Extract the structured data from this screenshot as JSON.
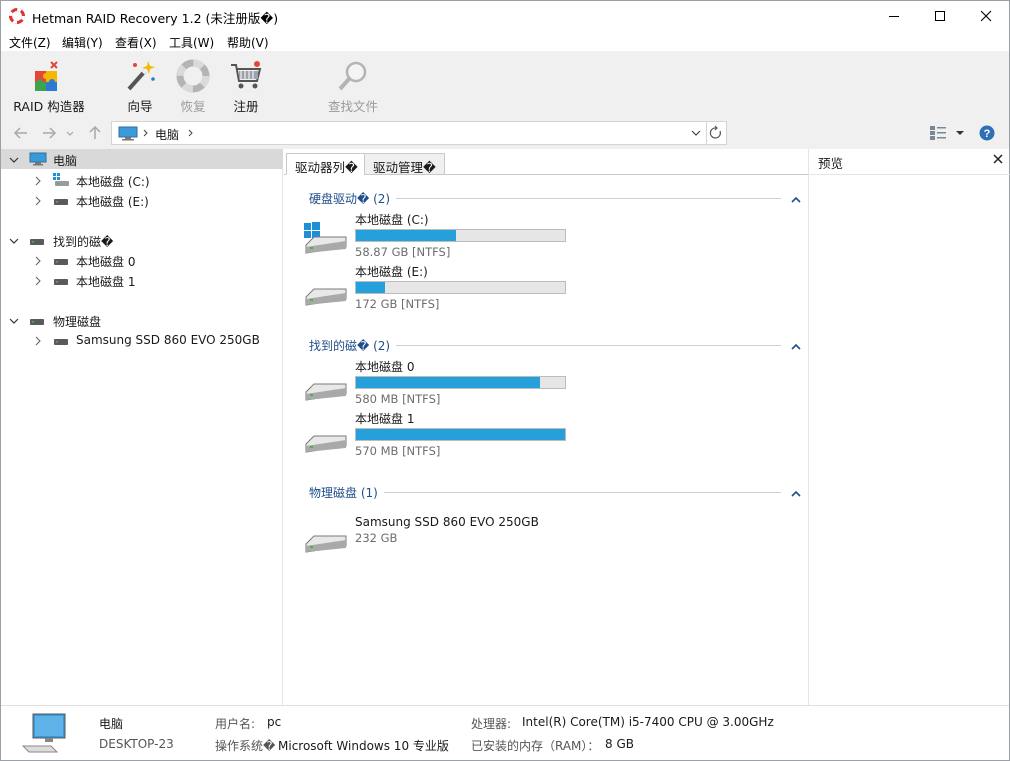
{
  "window": {
    "title": "Hetman RAID Recovery 1.2 (未注册版�)",
    "controls": [
      "minimize",
      "maximize",
      "close"
    ]
  },
  "menu": [
    "文件(Z)",
    "编辑(Y)",
    "查看(X)",
    "工具(W)",
    "帮助(V)"
  ],
  "toolbar": {
    "raid": "RAID 构造器",
    "wizard": "向导",
    "restore": "恢复",
    "register": "注册",
    "find": "查找文件"
  },
  "address": {
    "path": "电脑"
  },
  "tree": {
    "root": "电脑",
    "root_children": [
      "本地磁盘 (C:)",
      "本地磁盘 (E:)"
    ],
    "found": "找到的磁�",
    "found_children": [
      "本地磁盘 0",
      "本地磁盘 1"
    ],
    "physical": "物理磁盘",
    "physical_children": [
      "Samsung SSD 860 EVO 250GB"
    ]
  },
  "tabs": [
    "驱动器列�",
    "驱动管理�"
  ],
  "groups": [
    {
      "title": "硬盘驱动� (2)",
      "disks": [
        {
          "name": "本地磁盘 (C:)",
          "info": "58.87 GB [NTFS]",
          "used": 0.48,
          "os": true
        },
        {
          "name": "本地磁盘 (E:)",
          "info": "172 GB [NTFS]",
          "used": 0.14,
          "os": false
        }
      ]
    },
    {
      "title": "找到的磁� (2)",
      "disks": [
        {
          "name": "本地磁盘 0",
          "info": "580 MB [NTFS]",
          "used": 0.88,
          "os": false
        },
        {
          "name": "本地磁盘 1",
          "info": "570 MB [NTFS]",
          "used": 1.0,
          "os": false
        }
      ]
    },
    {
      "title": "物理磁盘 (1)",
      "disks": [
        {
          "name": "Samsung SSD 860 EVO 250GB",
          "info": "232 GB",
          "used": null,
          "os": false
        }
      ]
    }
  ],
  "preview": {
    "title": "预览"
  },
  "status": {
    "name": "电脑",
    "host": "DESKTOP-23",
    "user_label": "用户名:",
    "user_value": "pc",
    "os_label": "操作系统�",
    "os_value": "Microsoft Windows 10 专业版",
    "cpu_label": "处理器:",
    "cpu_value": "Intel(R) Core(TM) i5-7400 CPU @ 3.00GHz",
    "ram_label": "已安装的内存（RAM）：",
    "ram_value": "8 GB"
  },
  "colors": {
    "accent": "#26a0da",
    "group_title": "#1f4e8c",
    "selected_row": "#d9d9d9"
  }
}
